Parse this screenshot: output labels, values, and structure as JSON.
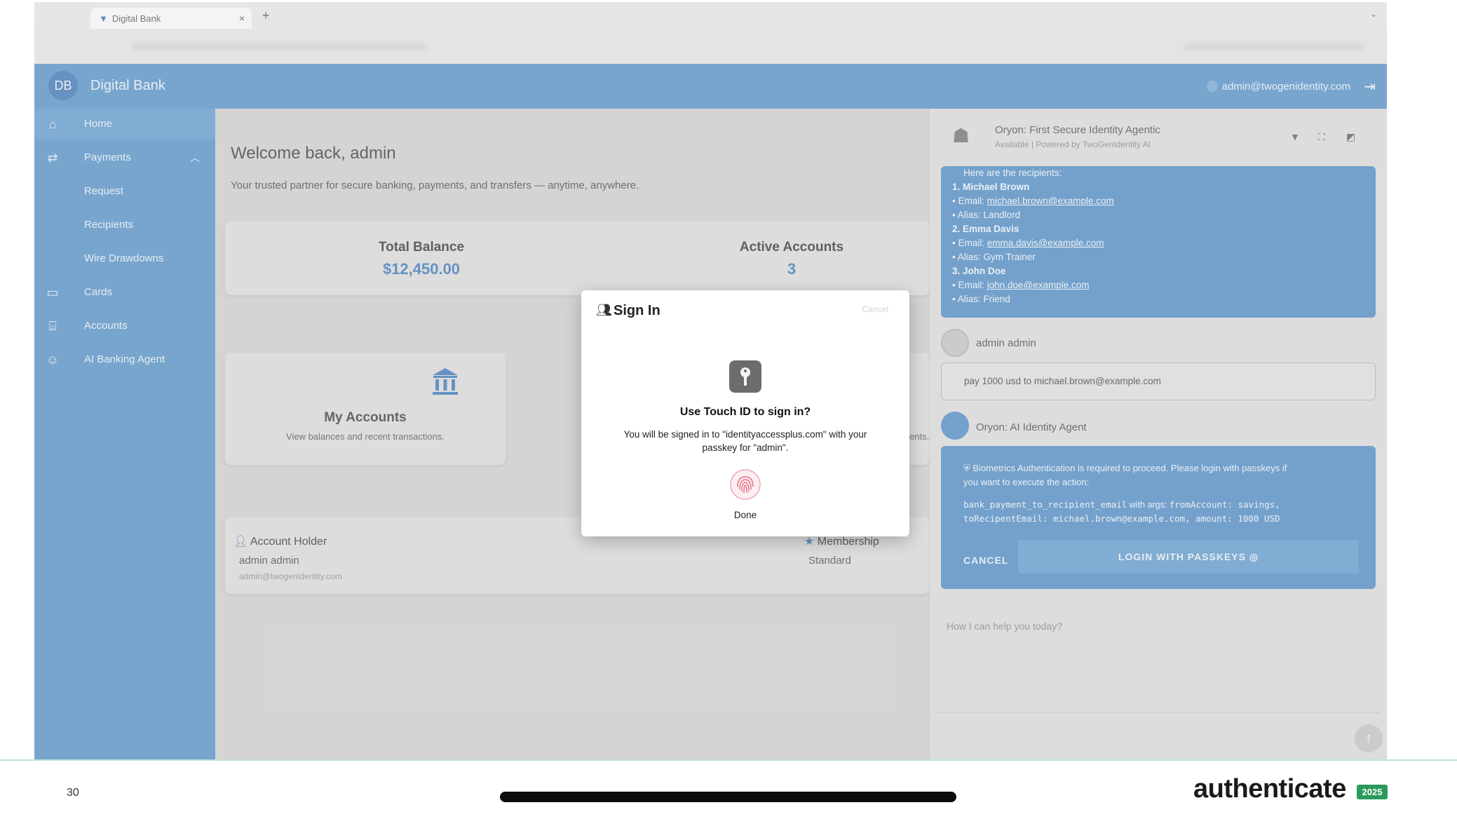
{
  "browser": {
    "tab_title": "Digital Bank",
    "tab_close": "×",
    "new_tab": "+",
    "tab_menu": "⌄"
  },
  "app": {
    "logo_initials": "DB",
    "title": "Digital Bank",
    "user_email": "admin@twogenidentity.com"
  },
  "sidebar": {
    "items": [
      {
        "label": "Home",
        "icon": "home-icon"
      },
      {
        "label": "Payments",
        "icon": "swap-icon"
      },
      {
        "label": "Request"
      },
      {
        "label": "Recipients"
      },
      {
        "label": "Wire Drawdowns"
      },
      {
        "label": "Cards",
        "icon": "card-icon"
      },
      {
        "label": "Accounts",
        "icon": "bank-icon"
      },
      {
        "label": "AI Banking Agent",
        "icon": "robot-icon"
      }
    ]
  },
  "main": {
    "welcome": "Welcome back, admin",
    "subline": "Your trusted partner for secure banking, payments, and transfers — anytime, anywhere.",
    "total_balance_label": "Total Balance",
    "total_balance_value": "$12,450.00",
    "active_accounts_label": "Active Accounts",
    "active_accounts_value": "3",
    "my_accounts_title": "My Accounts",
    "my_accounts_sub": "View balances and recent transactions.",
    "second_card_sub_tail": "ents.",
    "account_holder_label": "Account Holder",
    "account_holder_name": "admin admin",
    "account_holder_email": "admin@twogenidentity.com",
    "membership_label": "Membership",
    "membership_value": "Standard"
  },
  "chat": {
    "title": "Oryon: First Secure Identity Agentic",
    "subtitle": "Available | Powered by TwoGenIdentity AI",
    "recipients_intro": "Here are the recipients:",
    "recipients": [
      {
        "num": "1.",
        "name": "Michael Brown",
        "email_label": "Email:",
        "email": "michael.brown@example.com",
        "alias": "Alias: Landlord"
      },
      {
        "num": "2.",
        "name": "Emma Davis",
        "email_label": "Email:",
        "email": "emma.davis@example.com",
        "alias": "Alias: Gym Trainer"
      },
      {
        "num": "3.",
        "name": "John Doe",
        "email_label": "Email:",
        "email": "john.doe@example.com",
        "alias": "Alias: Friend"
      }
    ],
    "user_name": "admin admin",
    "user_message": "pay 1000 usd to michael.brown@example.com",
    "agent_name": "Oryon: AI Identity Agent",
    "auth_message_1": "Biometrics Authentication is required to proceed. Please login with passkeys if",
    "auth_message_2": "you want to execute the action:",
    "auth_code_1a": "bank_payment_to_recipient_email",
    "auth_code_1b": " with args: ",
    "auth_code_1c": "fromAccount: savings,",
    "auth_code_2": "toRecipentEmail: michael.brown@example.com, amount: 1000 USD",
    "cancel_label": "CANCEL",
    "passkey_label": "LOGIN WITH PASSKEYS",
    "input_placeholder": "How I can help you today?"
  },
  "modal": {
    "title": "Sign In",
    "cancel": "Cancel",
    "touch_title": "Use Touch ID to sign in?",
    "touch_body": "You will be signed in to \"identityaccessplus.com\" with your passkey for \"admin\".",
    "done": "Done"
  },
  "slide": {
    "number": "30",
    "brand": "authenticate",
    "brand_year": "2025"
  },
  "colors": {
    "accent": "#6fa3d2",
    "balance": "#5b8ec4",
    "brand_green": "#2c9a5a"
  }
}
